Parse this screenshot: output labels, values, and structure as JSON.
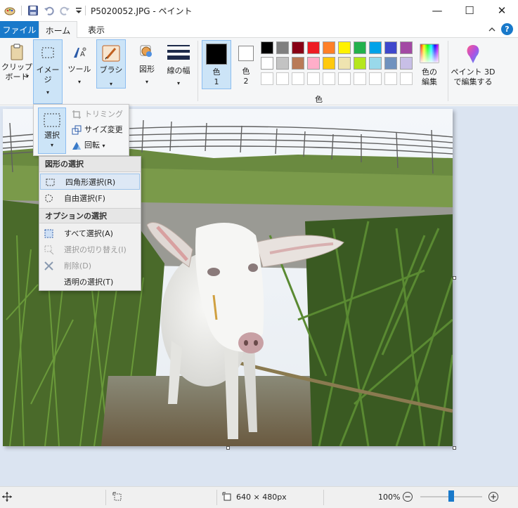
{
  "window": {
    "title": "P5020052.JPG - ペイント",
    "minimize": "—",
    "maximize": "☐",
    "close": "✕"
  },
  "menubar": {
    "file_tab": "ファイル",
    "home_tab": "ホーム",
    "view_tab": "表示",
    "help": "?"
  },
  "ribbon": {
    "clipboard": "クリップ\nボード",
    "image": "イメージ",
    "tools": "ツール",
    "brush": "ブラシ",
    "shapes": "図形",
    "line_width": "線の幅",
    "color1_label": "色",
    "color1_num": "1",
    "color2_label": "色",
    "color2_num": "2",
    "colors_group": "色",
    "edit_colors": "色の\n編集",
    "paint3d": "ペイント 3D\nで編集する",
    "color1_value": "#000000",
    "color2_value": "#ffffff",
    "palette_row1": [
      "#000000",
      "#7f7f7f",
      "#880015",
      "#ed1c24",
      "#ff7f27",
      "#fff200",
      "#22b14c",
      "#00a2e8",
      "#3f48cc",
      "#a349a4"
    ],
    "palette_row2": [
      "#ffffff",
      "#c3c3c3",
      "#b97a57",
      "#ffaec9",
      "#ffc90e",
      "#efe4b0",
      "#b5e61d",
      "#99d9ea",
      "#7092be",
      "#c8bfe7"
    ]
  },
  "image_dropdown": {
    "select_label": "選択",
    "trim": "トリミング",
    "resize": "サイズ変更",
    "rotate": "回転"
  },
  "selection_menu": {
    "header_shape": "図形の選択",
    "rect_select": "四角形選択(R)",
    "free_select": "自由選択(F)",
    "header_options": "オプションの選択",
    "select_all": "すべて選択(A)",
    "invert": "選択の切り替え(I)",
    "delete": "削除(D)",
    "transparent": "透明の選択(T)"
  },
  "statusbar": {
    "dimensions": "640 × 480px",
    "zoom": "100%",
    "zoom_level_percent": 100
  }
}
